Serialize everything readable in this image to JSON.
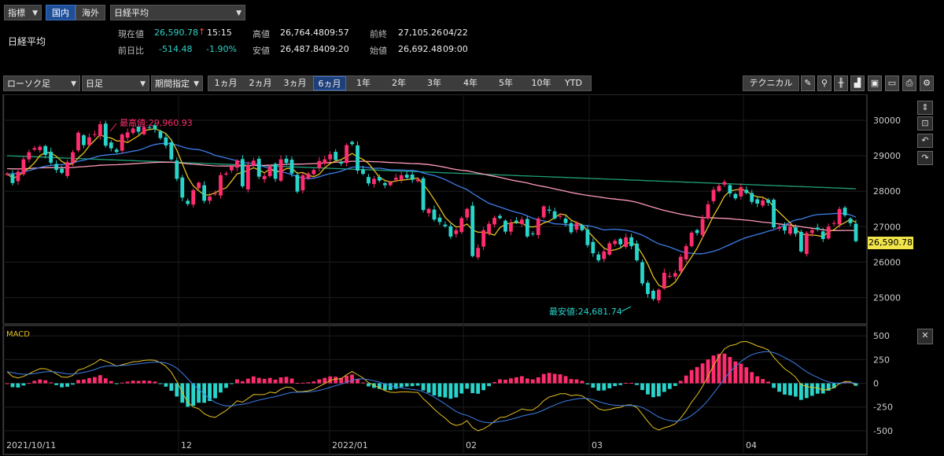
{
  "top": {
    "indicator_select": "指標",
    "tab_domestic": "国内",
    "tab_overseas": "海外",
    "index_select": "日経平均",
    "index_name": "日経平均"
  },
  "quote": {
    "current_label": "現在値",
    "current_value": "26,590.78",
    "current_arrow": "↑",
    "current_time": "15:15",
    "change_label": "前日比",
    "change_value": "-514.48",
    "change_pct": "-1.90%",
    "high_label": "高値",
    "high_value": "26,764.48",
    "high_time": "09:57",
    "low_label": "安値",
    "low_value": "26,487.84",
    "low_time": "09:20",
    "prev_close_label": "前終",
    "prev_close_value": "27,105.26",
    "prev_close_date": "04/22",
    "open_label": "始値",
    "open_value": "26,692.48",
    "open_time": "09:00"
  },
  "chart_toolbar": {
    "chart_type": "ローソク足",
    "interval": "日足",
    "period_mode": "期間指定",
    "periods": [
      "1ヵ月",
      "2ヵ月",
      "3ヵ月",
      "6ヵ月",
      "1年",
      "2年",
      "3年",
      "4年",
      "5年",
      "10年",
      "YTD"
    ],
    "active_period": "6ヵ月",
    "technical_button": "テクニカル"
  },
  "colors": {
    "up": "#ff2d6e",
    "down": "#29d4cb",
    "ma_short": "#e6c020",
    "ma_mid": "#3d7ee8",
    "ma_long": "#ff9bb8",
    "ma_longest": "#1fa07a",
    "highlight": "#f2e54a"
  },
  "chart_data": [
    {
      "type": "candlestick",
      "title": "",
      "yticks": [
        25000,
        26000,
        27000,
        28000,
        29000,
        30000
      ],
      "ylim": [
        24300,
        30600
      ],
      "xticks": [
        "2021/10/11",
        "12",
        "2022/01",
        "02",
        "03",
        "04"
      ],
      "current_price_label": "26,590.78",
      "high_annotation": "最高値:29,960.93",
      "low_annotation": "最安値:24,681.74",
      "closes": [
        28498,
        28230,
        28550,
        28900,
        29100,
        29215,
        29255,
        29025,
        28805,
        28600,
        28520,
        28820,
        29100,
        29650,
        29300,
        29520,
        29610,
        29890,
        29285,
        29210,
        29106,
        29600,
        29660,
        29770,
        29680,
        29810,
        29790,
        29745,
        29500,
        29290,
        28900,
        28350,
        27820,
        27640,
        28030,
        28240,
        27730,
        27850,
        27933,
        28454,
        28500,
        28700,
        28870,
        28140,
        28740,
        28860,
        28410,
        28430,
        28700,
        28350,
        28900,
        28800,
        28500,
        27990,
        28450,
        28500,
        28600,
        28850,
        28900,
        29040,
        28880,
        28780,
        29300,
        29330,
        28580,
        28490,
        28220,
        28350,
        28300,
        28170,
        28250,
        28380,
        28450,
        28380,
        28320,
        28330,
        27470,
        27500,
        27200,
        27130,
        27010,
        26720,
        26900,
        27240,
        27500,
        26170,
        26400,
        26900,
        27080,
        27250,
        27240,
        26860,
        27100,
        27130,
        27200,
        26720,
        26800,
        27230,
        27570,
        27450,
        27230,
        27300,
        27100,
        26840,
        27100,
        26900,
        26480,
        26250,
        26050,
        26300,
        26530,
        26600,
        26500,
        26700,
        26450,
        26050,
        25400,
        25100,
        24960,
        25220,
        25700,
        25610,
        25690,
        26150,
        26450,
        26830,
        26820,
        27220,
        27630,
        28040,
        28150,
        28260,
        27940,
        27800,
        28110,
        27950,
        27700,
        27650,
        27740,
        27670,
        26980,
        26990,
        26890,
        27000,
        26800,
        26300,
        26820,
        26900,
        26920,
        26650,
        27000,
        27100,
        27500,
        27320,
        27100,
        26590
      ]
    },
    {
      "type": "line",
      "title": "MACD",
      "yticks": [
        -500,
        -250,
        0,
        250,
        500
      ],
      "ylim": [
        -700,
        560
      ]
    }
  ]
}
